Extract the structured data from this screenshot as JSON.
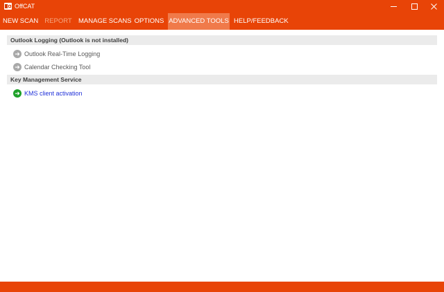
{
  "window": {
    "title": "OffCAT"
  },
  "menu": {
    "new_scan": "NEW SCAN",
    "report": "REPORT",
    "manage_scans": "MANAGE SCANS",
    "options": "OPTIONS",
    "advanced_tools": "ADVANCED TOOLS",
    "help_feedback": "HELP/FEEDBACK",
    "active": "ADVANCED TOOLS"
  },
  "outlook_section": {
    "header": "Outlook Logging (Outlook is not installed)",
    "items": [
      {
        "label": "Outlook Real-Time Logging",
        "icon": "arrow-circle-gray-icon",
        "enabled": false
      },
      {
        "label": "Calendar Checking Tool",
        "icon": "arrow-circle-gray-icon",
        "enabled": false
      }
    ]
  },
  "kms_section": {
    "header": "Key Management Service",
    "items": [
      {
        "label": "KMS client activation",
        "icon": "arrow-circle-green-icon",
        "enabled": true
      }
    ]
  },
  "colors": {
    "brand": "#e84407",
    "active_tab": "#f07a4a",
    "section_header_bg": "#ebebeb",
    "link": "#1f30d9",
    "enabled_icon": "#1ea12a",
    "disabled_icon": "#a9a9a9"
  }
}
